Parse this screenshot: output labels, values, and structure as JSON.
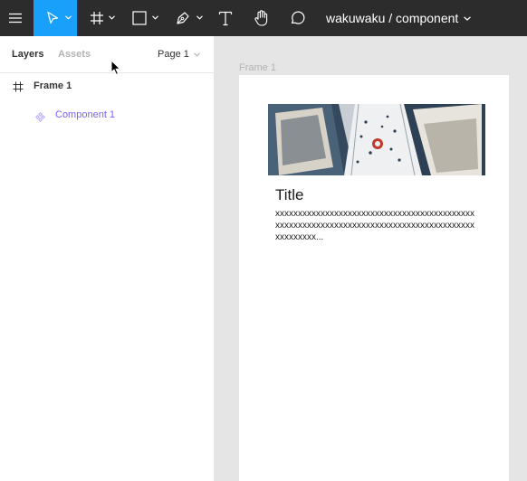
{
  "toolbar": {
    "icons": [
      "menu-icon",
      "move-tool-icon",
      "frame-tool-icon",
      "shape-tool-icon",
      "pen-tool-icon",
      "text-tool-icon",
      "hand-tool-icon",
      "comment-icon"
    ],
    "active_tool": "move-tool-icon",
    "active_color": "#18a0fb",
    "document_title": "wakuwaku / component"
  },
  "left_panel": {
    "tabs": {
      "layers": "Layers",
      "assets": "Assets"
    },
    "page_select": "Page 1",
    "layers": [
      {
        "name": "Frame 1",
        "icon": "frame-icon"
      },
      {
        "name": "Component 1",
        "icon": "component-icon",
        "color": "#7b61ff"
      }
    ]
  },
  "canvas": {
    "frame_label": "Frame 1",
    "card": {
      "title": "Title",
      "body": "xxxxxxxxxxxxxxxxxxxxxxxxxxxxxxxxxxxxxxxxxxxxxxxxxxxxxxxxxxxxxxxxxxxxxxxxxxxxxxxxxxxxxxxxxxxxxxxxx..."
    }
  }
}
